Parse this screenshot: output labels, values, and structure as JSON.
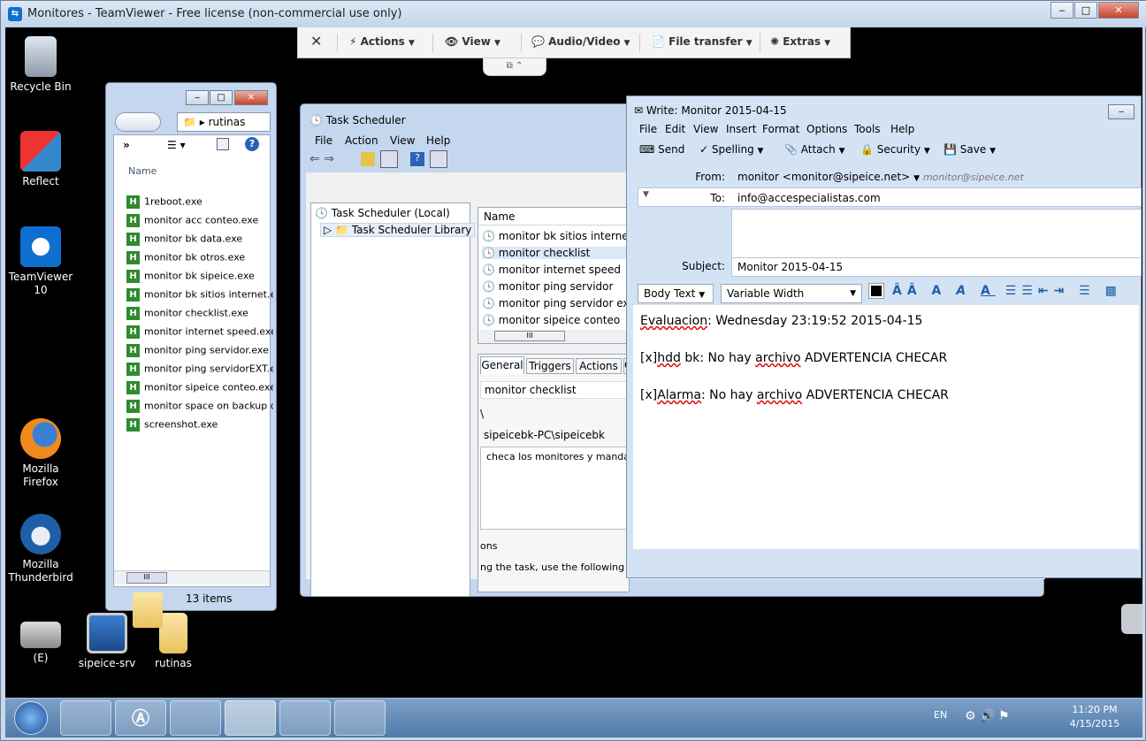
{
  "window": {
    "title": "Monitores - TeamViewer - Free license (non-commercial use only)",
    "min": "‒",
    "max": "□",
    "close": "✕"
  },
  "tvbar": {
    "close": "✕",
    "actions": "Actions",
    "view": "View",
    "audio_video": "Audio/Video",
    "file_transfer": "File transfer",
    "extras": "Extras",
    "caret": "▼",
    "tab_icons": "⧉  ⌃"
  },
  "desktop": {
    "icons": [
      "Recycle Bin",
      "Reflect",
      "TeamViewer 10",
      "Mozilla Firefox",
      "Mozilla Thunderbird",
      "(E)",
      "sipeice-srv",
      "rutinas"
    ]
  },
  "explorer": {
    "path": "rutinas",
    "column": "Name",
    "status": "13 items",
    "chevron": "»",
    "hscroll": "III",
    "files": [
      "1reboot.exe",
      "monitor acc conteo.exe",
      "monitor bk data.exe",
      "monitor bk otros.exe",
      "monitor bk sipeice.exe",
      "monitor bk sitios internet.exe",
      "monitor checklist.exe",
      "monitor internet speed.exe",
      "monitor ping servidor.exe",
      "monitor ping servidorEXT.exe",
      "monitor sipeice conteo.exe",
      "monitor space on backup drive.exe",
      "screenshot.exe"
    ]
  },
  "scheduler": {
    "title": "Task Scheduler",
    "menu": [
      "File",
      "Action",
      "View",
      "Help"
    ],
    "tree": [
      "Task Scheduler (Local)",
      "Task Scheduler Library"
    ],
    "col_name": "Name",
    "tasks": [
      "monitor bk sitios internet",
      "monitor checklist",
      "monitor internet speed",
      "monitor ping servidor",
      "monitor ping servidor ext",
      "monitor sipeice conteo"
    ],
    "tabs": [
      "General",
      "Triggers",
      "Actions",
      "C"
    ],
    "field_name": "monitor checklist",
    "field_location": "\\",
    "field_author": "sipeicebk-PC\\sipeicebk",
    "field_desc": "checa los monitores y manda m",
    "sec_options": "ons",
    "sec_text": "ng the task, use the following us",
    "hscroll": "III"
  },
  "compose": {
    "title": "Write: Monitor 2015-04-15",
    "menu": [
      "File",
      "Edit",
      "View",
      "Insert",
      "Format",
      "Options",
      "Tools",
      "Help"
    ],
    "toolbar": {
      "send": "Send",
      "spelling": "Spelling",
      "attach": "Attach",
      "security": "Security",
      "save": "Save"
    },
    "from_label": "From:",
    "from_value": "monitor <monitor@sipeice.net>",
    "from_extra": "monitor@sipeice.net",
    "to_label": "To:",
    "to_value": "info@accespecialistas.com",
    "subject_label": "Subject:",
    "subject_value": "Monitor 2015-04-15",
    "paragraph_style": "Body Text",
    "font": "Variable Width",
    "body": {
      "l1a": "Evaluacion",
      "l1b": ": Wednesday 23:19:52   2015-04-15",
      "l2a": "[x]",
      "l2b": "hdd",
      "l2c": " bk: No hay ",
      "l2d": "archivo",
      "l2e": " ADVERTENCIA CHECAR",
      "l3a": "[x]",
      "l3b": "Alarma",
      "l3c": ": No hay ",
      "l3d": "archivo",
      "l3e": " ADVERTENCIA CHECAR"
    }
  },
  "taskbar": {
    "lang": "EN",
    "time": "11:20 PM",
    "date": "4/15/2015"
  }
}
